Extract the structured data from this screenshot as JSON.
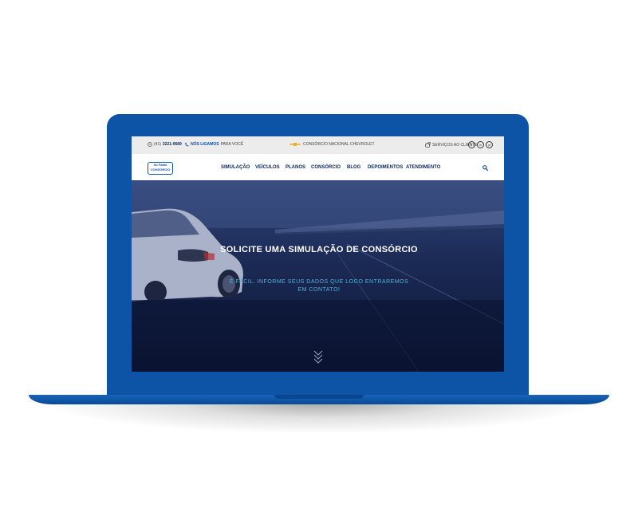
{
  "topbar": {
    "phone_prefix": "(41)",
    "phone_number": "3221-9689",
    "call_bold": "NÓS LIGAMOS",
    "call_rest": "PARA VOCÊ",
    "brand_text": "CONSÓRCIO NACIONAL CHEVROLET",
    "client_link": "SERVIÇOS AO CLIENTE",
    "social": [
      "f",
      "in",
      "yt"
    ]
  },
  "navbar": {
    "logo_line1": "Só Fabio",
    "logo_line2": "CONSÓRCIO",
    "items": [
      "SIMULAÇÃO",
      "VEÍCULOS",
      "PLANOS",
      "CONSÓRCIO",
      "BLOG",
      "DEPOIMENTOS",
      "ATENDIMENTO"
    ]
  },
  "hero": {
    "title": "SOLICITE UMA SIMULAÇÃO DE CONSÓRCIO",
    "subtitle": "É FÁCIL. INFORME SEUS DADOS QUE LOGO ENTRAREMOS EM CONTATO!"
  },
  "colors": {
    "frame": "#0d53a6",
    "accent": "#4fb2d8",
    "nav_text": "#0d2a5c"
  }
}
